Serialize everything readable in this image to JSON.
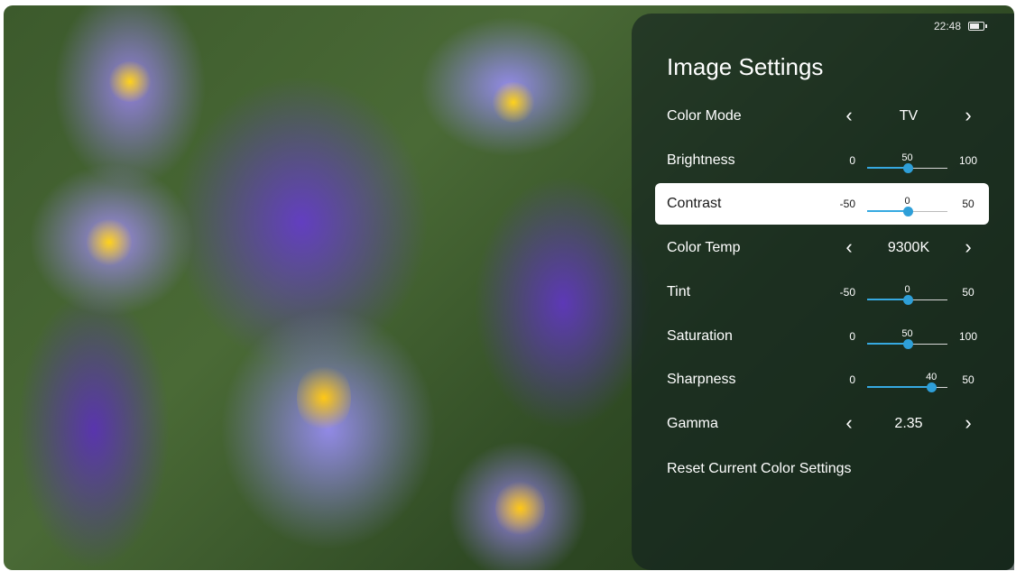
{
  "status": {
    "time": "22:48",
    "battery_icon": "battery-icon"
  },
  "panel": {
    "title": "Image Settings"
  },
  "settings": [
    {
      "label": "Color Mode",
      "type": "choice",
      "value": "TV"
    },
    {
      "label": "Brightness",
      "type": "slider",
      "min": "0",
      "max": "100",
      "value": "50",
      "fraction": 0.5
    },
    {
      "label": "Contrast",
      "type": "slider",
      "min": "-50",
      "max": "50",
      "value": "0",
      "fraction": 0.5,
      "selected": true
    },
    {
      "label": "Color Temp",
      "type": "choice",
      "value": "9300K"
    },
    {
      "label": "Tint",
      "type": "slider",
      "min": "-50",
      "max": "50",
      "value": "0",
      "fraction": 0.5
    },
    {
      "label": "Saturation",
      "type": "slider",
      "min": "0",
      "max": "100",
      "value": "50",
      "fraction": 0.5
    },
    {
      "label": "Sharpness",
      "type": "slider",
      "min": "0",
      "max": "50",
      "value": "40",
      "fraction": 0.8
    },
    {
      "label": "Gamma",
      "type": "choice",
      "value": "2.35"
    }
  ],
  "reset_label": "Reset Current Color Settings",
  "icons": {
    "left": "‹",
    "right": "›"
  },
  "colors": {
    "accent": "#2e9fd8",
    "panel_bg": "rgba(18,32,30,0.62)",
    "selected_bg": "#ffffff"
  }
}
